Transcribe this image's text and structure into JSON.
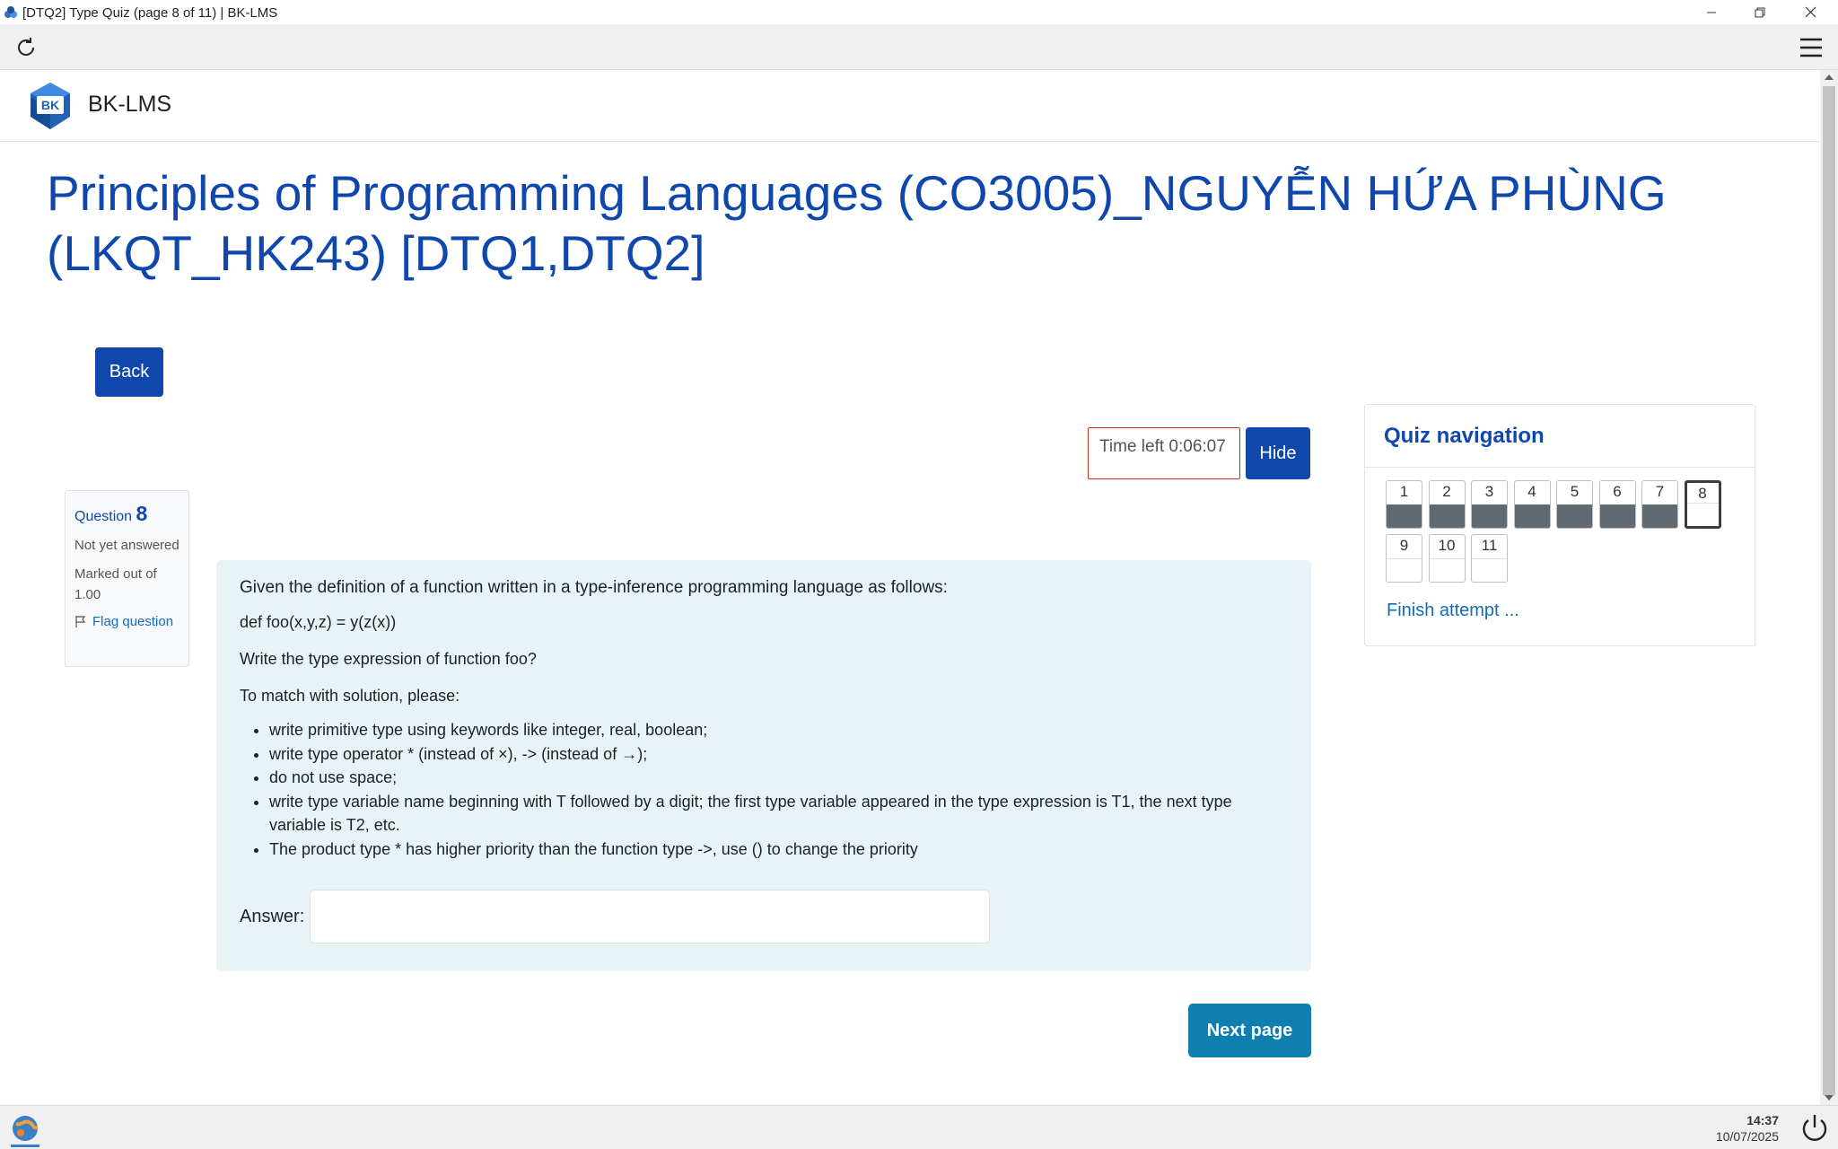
{
  "window": {
    "title": "[DTQ2] Type Quiz (page 8 of 11) | BK-LMS"
  },
  "site": {
    "brand": "BK-LMS",
    "logo_text": "BK"
  },
  "course": {
    "title": "Principles of Programming Languages (CO3005)_NGUYỄN HỨA PHÙNG (LKQT_HK243) [DTQ1,DTQ2]"
  },
  "buttons": {
    "back": "Back",
    "hide": "Hide",
    "next_page": "Next page"
  },
  "timer": {
    "text": "Time left 0:06:07"
  },
  "question_info": {
    "label": "Question",
    "number": "8",
    "state": "Not yet answered",
    "grade": "Marked out of 1.00",
    "flag_label": "Flag question"
  },
  "question": {
    "intro": "Given the definition of a function written in a type-inference programming language as follows:",
    "code": "def foo(x,y,z) = y(z(x))",
    "task": "Write the type expression of function foo?",
    "match_note": "To match with solution, please:",
    "rules": [
      "write primitive type using keywords like integer, real, boolean;",
      "write type operator * (instead of ×), -> (instead of →);",
      "do not use space;",
      "write type variable name beginning with T followed by a digit; the first type variable appeared in the type expression is T1, the next type variable is  T2, etc.",
      "The product type * has higher priority than the function type ->, use () to change the priority"
    ],
    "answer_label": "Answer:",
    "answer_value": ""
  },
  "quiz_nav": {
    "title": "Quiz navigation",
    "items": [
      {
        "label": "1",
        "state": "answered"
      },
      {
        "label": "2",
        "state": "answered"
      },
      {
        "label": "3",
        "state": "answered"
      },
      {
        "label": "4",
        "state": "answered"
      },
      {
        "label": "5",
        "state": "answered"
      },
      {
        "label": "6",
        "state": "answered"
      },
      {
        "label": "7",
        "state": "answered"
      },
      {
        "label": "8",
        "state": "current"
      },
      {
        "label": "9",
        "state": "not-answered"
      },
      {
        "label": "10",
        "state": "not-answered"
      },
      {
        "label": "11",
        "state": "not-answered"
      }
    ],
    "finish_label": "Finish attempt ..."
  },
  "taskbar": {
    "time": "14:37",
    "date": "10/07/2025"
  },
  "colors": {
    "primary": "#0f47ad",
    "next_button": "#0f7fb0",
    "question_bg": "#e7f3f5",
    "timer_border": "#ca3120",
    "answered_fill": "#5f6a73"
  }
}
